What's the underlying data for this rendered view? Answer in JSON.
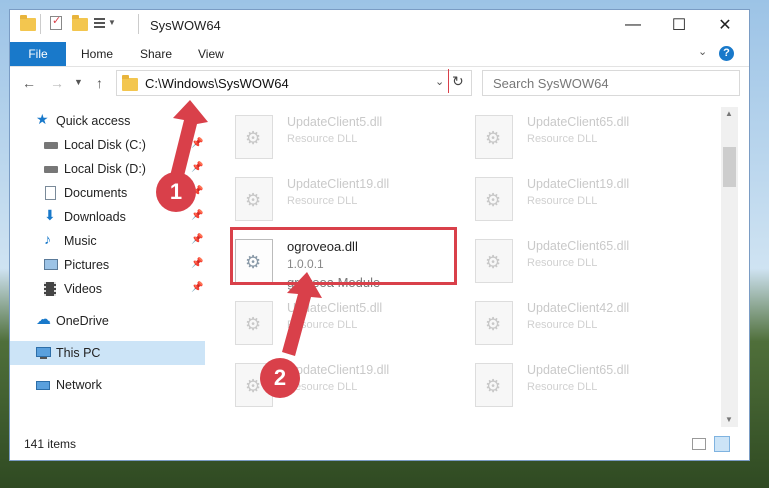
{
  "window": {
    "title": "SysWOW64"
  },
  "controls": {
    "minimize": "—",
    "maximize": "☐",
    "close": "✕"
  },
  "ribbon": {
    "file": "File",
    "home": "Home",
    "share": "Share",
    "view": "View",
    "help": "?"
  },
  "address": {
    "path": "C:\\Windows\\SysWOW64",
    "search_placeholder": "Search SysWOW64"
  },
  "sidebar": {
    "items": [
      {
        "label": "Quick access",
        "icon": "star-icon"
      },
      {
        "label": "Local Disk (C:)",
        "icon": "drive-icon"
      },
      {
        "label": "Local Disk (D:)",
        "icon": "drive-icon"
      },
      {
        "label": "Documents",
        "icon": "documents-icon"
      },
      {
        "label": "Downloads",
        "icon": "download-icon"
      },
      {
        "label": "Music",
        "icon": "music-icon"
      },
      {
        "label": "Pictures",
        "icon": "pictures-icon"
      },
      {
        "label": "Videos",
        "icon": "videos-icon"
      },
      {
        "label": "OneDrive",
        "icon": "cloud-icon"
      },
      {
        "label": "This PC",
        "icon": "computer-icon"
      },
      {
        "label": "Network",
        "icon": "network-icon"
      }
    ]
  },
  "files": {
    "left": [
      {
        "name": "UpdateClient5.dll",
        "type": "Resource DLL"
      },
      {
        "name": "UpdateClient19.dll",
        "type": "Resource DLL"
      },
      {
        "name": "ogroveoa.dll",
        "type": "1.0.0.1",
        "desc": "groveoa Module"
      },
      {
        "name": "UpdateClient5.dll",
        "type": "Resource DLL"
      },
      {
        "name": "UpdateClient19.dll",
        "type": "Resource DLL"
      }
    ],
    "right": [
      {
        "name": "UpdateClient65.dll",
        "type": "Resource DLL"
      },
      {
        "name": "UpdateClient19.dll",
        "type": "Resource DLL"
      },
      {
        "name": "UpdateClient65.dll",
        "type": "Resource DLL"
      },
      {
        "name": "UpdateClient42.dll",
        "type": "Resource DLL"
      },
      {
        "name": "UpdateClient65.dll",
        "type": "Resource DLL"
      }
    ]
  },
  "status": {
    "count": "141 items"
  },
  "callouts": {
    "one": "1",
    "two": "2"
  },
  "colors": {
    "accent": "#1979ca",
    "callout": "#d9404a",
    "selection": "#cce4f7"
  }
}
